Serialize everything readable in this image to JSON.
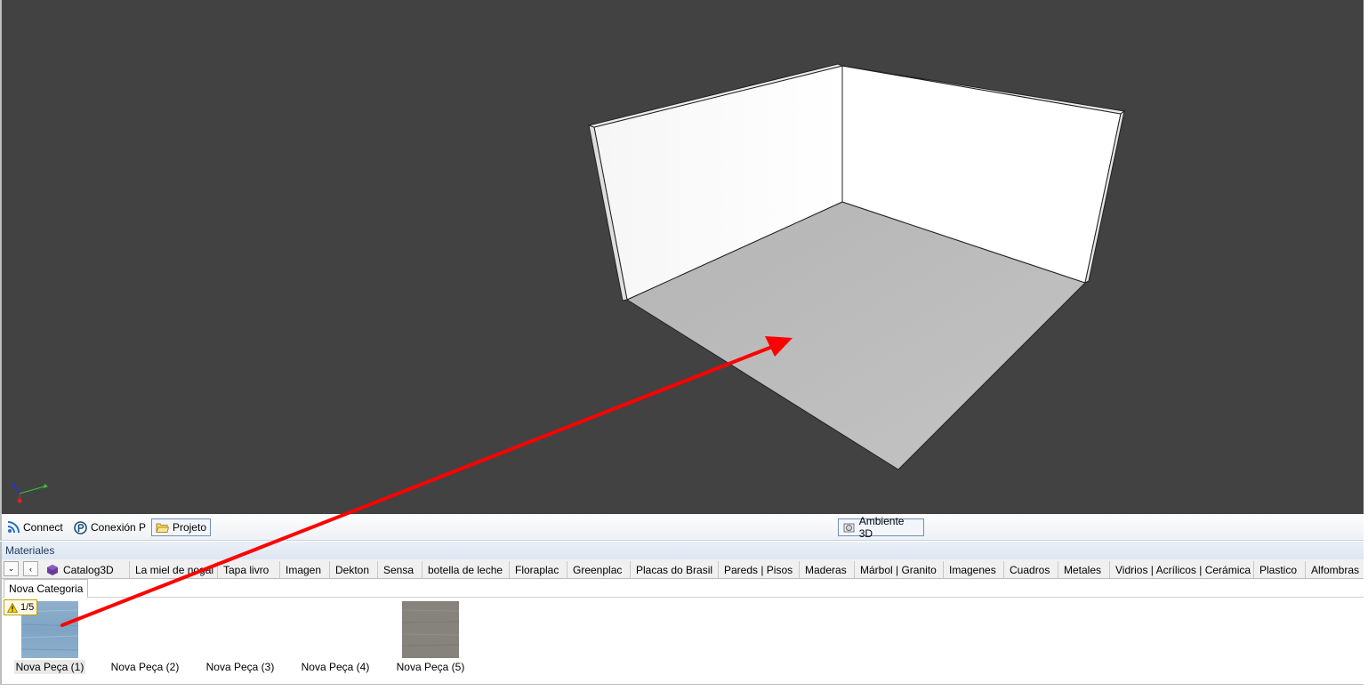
{
  "toolbar": {
    "connect_label": "Connect",
    "conexion_label": "Conexión P",
    "projeto_label": "Projeto",
    "ambiente_label": "Ambiente 3D"
  },
  "materials": {
    "title": "Materiales",
    "categories": [
      "Catalog3D",
      "La miel de nogal",
      "Tapa livro",
      "Imagen",
      "Dekton",
      "Sensa",
      "botella de leche",
      "Floraplac",
      "Greenplac",
      "Placas do Brasil",
      "Pareds | Pisos",
      "Maderas",
      "Márbol | Granito",
      "Imagenes",
      "Cuadros",
      "Metales",
      "Vidrios | Acrílicos | Cerámica",
      "Plastico",
      "Alfombras"
    ],
    "subcategory": "Nova Categoria",
    "badge": "1/5",
    "items": [
      "Nova Peça (1)",
      "Nova Peça (2)",
      "Nova Peça (3)",
      "Nova Peça (4)",
      "Nova Peça (5)"
    ]
  },
  "colors": {
    "viewport_bg": "#424242",
    "annotation_arrow": "#ff0000",
    "accent": "#6f8fb6"
  },
  "icons": [
    "rss-icon",
    "conexion-icon",
    "folder-icon",
    "ambiente-icon",
    "cube-icon",
    "warning-icon",
    "axis-gizmo-icon"
  ]
}
